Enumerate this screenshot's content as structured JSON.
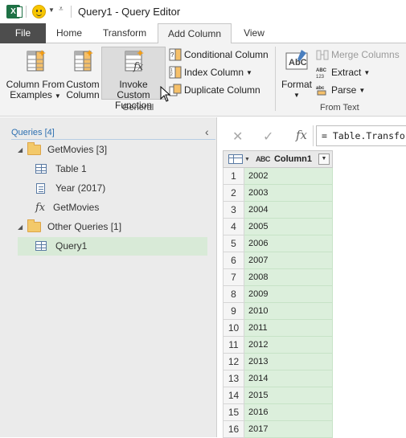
{
  "window": {
    "title": "Query1 - Query Editor"
  },
  "ribbon_tabs": [
    "File",
    "Home",
    "Transform",
    "Add Column",
    "View"
  ],
  "ribbon": {
    "column_from_examples": [
      "Column From",
      "Examples"
    ],
    "custom_column": [
      "Custom",
      "Column"
    ],
    "invoke_custom_function": [
      "Invoke Custom",
      "Function"
    ],
    "conditional_column": "Conditional Column",
    "index_column": "Index Column",
    "duplicate_column": "Duplicate Column",
    "group_general": "General",
    "format": "Format",
    "merge_columns": "Merge Columns",
    "extract": "Extract",
    "parse": "Parse",
    "group_from_text": "From Text"
  },
  "queries": {
    "header": "Queries [4]",
    "items": [
      {
        "label": "GetMovies [3]",
        "type": "folder"
      },
      {
        "label": "Table 1",
        "type": "table"
      },
      {
        "label": "Year (2017)",
        "type": "list"
      },
      {
        "label": "GetMovies",
        "type": "function"
      },
      {
        "label": "Other Queries [1]",
        "type": "folder"
      },
      {
        "label": "Query1",
        "type": "table",
        "selected": true
      }
    ]
  },
  "formula_bar": {
    "text": "= Table.Transfor"
  },
  "grid": {
    "column_type": "ABC",
    "column_name": "Column1",
    "row_numbers": [
      "1",
      "2",
      "3",
      "4",
      "5",
      "6",
      "7",
      "8",
      "9",
      "10",
      "11",
      "12",
      "13",
      "14",
      "15",
      "16"
    ],
    "values": [
      "2002",
      "2003",
      "2004",
      "2005",
      "2006",
      "2007",
      "2008",
      "2009",
      "2010",
      "2011",
      "2012",
      "2013",
      "2014",
      "2015",
      "2016",
      "2017"
    ]
  },
  "colors": {
    "selected_bg": "#d8ead7",
    "column_bg": "#dcefdc",
    "accent_blue": "#2c6fb0"
  }
}
